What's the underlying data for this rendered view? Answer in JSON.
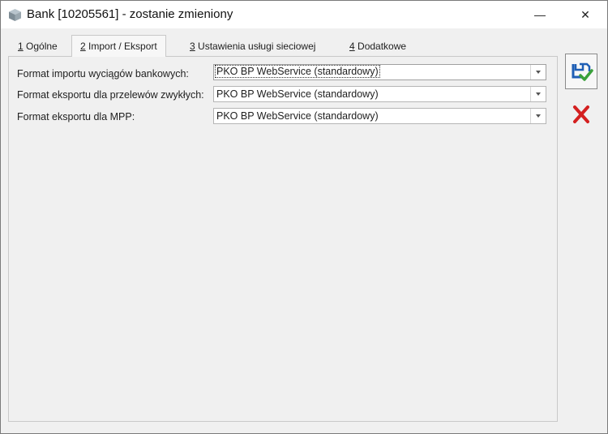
{
  "window": {
    "title": "Bank [10205561] - zostanie zmieniony",
    "minimize_glyph": "—",
    "close_glyph": "✕"
  },
  "tabs": [
    {
      "key": "1",
      "label": " Ogólne",
      "active": false
    },
    {
      "key": "2",
      "label": " Import / Eksport",
      "active": true
    },
    {
      "key": "3",
      "label": " Ustawienia usługi sieciowej",
      "active": false
    },
    {
      "key": "4",
      "label": " Dodatkowe",
      "active": false
    }
  ],
  "form": {
    "import_label": "Format importu wyciągów bankowych:",
    "import_value": "PKO BP WebService (standardowy)",
    "export_label": "Format eksportu dla przelewów zwykłych:",
    "export_value": "PKO BP WebService (standardowy)",
    "mpp_label": "Format eksportu dla MPP:",
    "mpp_value": "PKO BP WebService (standardowy)"
  },
  "actions": {
    "save_icon": "save-check-icon",
    "cancel_icon": "red-x-icon"
  },
  "colors": {
    "accent_blue": "#1f5fb5",
    "check_green": "#3aa13a",
    "cancel_red": "#d42020"
  }
}
